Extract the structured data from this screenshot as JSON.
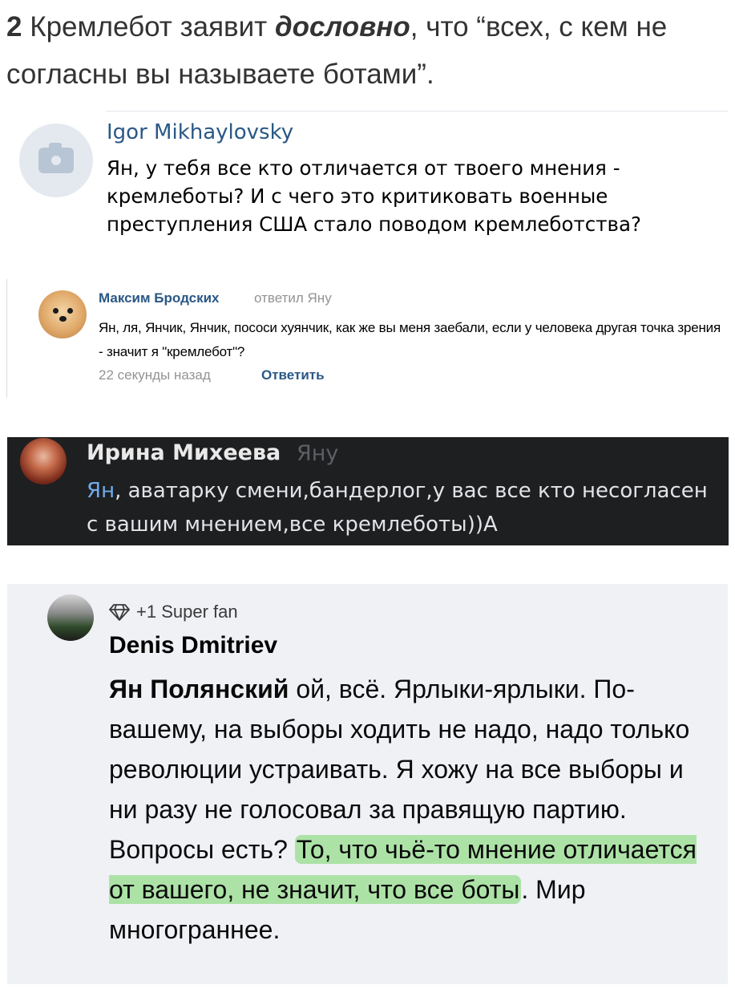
{
  "intro": {
    "number": "2",
    "before": " Кремлебот заявит ",
    "emphasis": "дословно",
    "after": ", что “всех, с кем не согласны вы называете ботами”."
  },
  "comment_igor": {
    "author": "Igor Mikhaylovsky",
    "text": "Ян, у тебя все кто отличается от твоего мнения - кремлеботы? И с чего это критиковать военные преступления США стало поводом кремлеботства?",
    "avatar_icon": "camera-icon"
  },
  "comment_maxim": {
    "author": "Максим Бродских",
    "replied_to": "ответил Яну",
    "text": "Ян, ля, Янчик, Янчик, пососи хуянчик, как же вы меня заебали, если у человека другая точка зрения - значит я \"кремлебот\"?",
    "time": "22 секунды назад",
    "reply_label": "Ответить"
  },
  "comment_irina": {
    "author": "Ирина Михеева",
    "addressee": "Яну",
    "mention": "Ян",
    "text": ", аватарку смени,бандерлог,у вас все кто несогласен с вашим мнением,все кремлеботы))А"
  },
  "comment_denis": {
    "badge": "+1 Super fan",
    "author": "Denis Dmitriev",
    "reply_to": "Ян Полянский",
    "text_before": " ой, всё. Ярлыки-ярлыки. По-вашему, на выборы ходить не надо, надо только революции устраивать. Я хожу на все выборы и ни разу не голосовал за правящую партию. Вопросы есть? ",
    "highlighted": "То, что чьё-то мнение отличается от вашего, не значит, что все боты",
    "text_after": ". Мир многограннее.",
    "highlight_color": "#84d978"
  }
}
